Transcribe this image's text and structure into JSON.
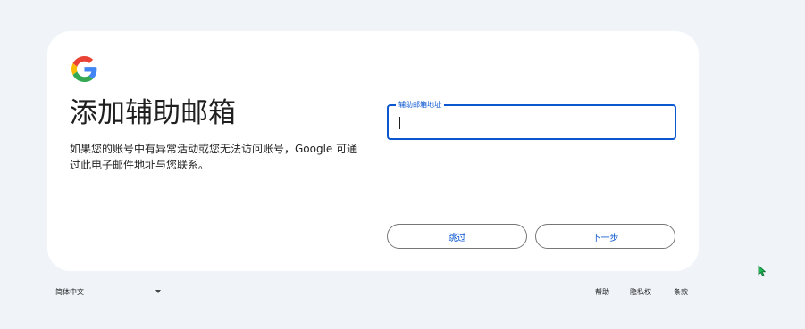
{
  "card": {
    "title": "添加辅助邮箱",
    "description": "如果您的账号中有异常活动或您无法访问账号，Google 可通过此电子邮件地址与您联系。"
  },
  "field": {
    "label": "辅助邮箱地址",
    "value": ""
  },
  "buttons": {
    "skip": "跳过",
    "next": "下一步"
  },
  "footer": {
    "language": "简体中文",
    "links": [
      "帮助",
      "隐私权",
      "条款"
    ]
  },
  "colors": {
    "accent": "#0b57d0",
    "background": "#f0f4f9",
    "card": "#ffffff",
    "cursor": "#1db954"
  },
  "icons": {
    "logo": "google-g-logo-icon",
    "dropdown": "chevron-down-icon",
    "pointer": "mouse-pointer-icon"
  }
}
